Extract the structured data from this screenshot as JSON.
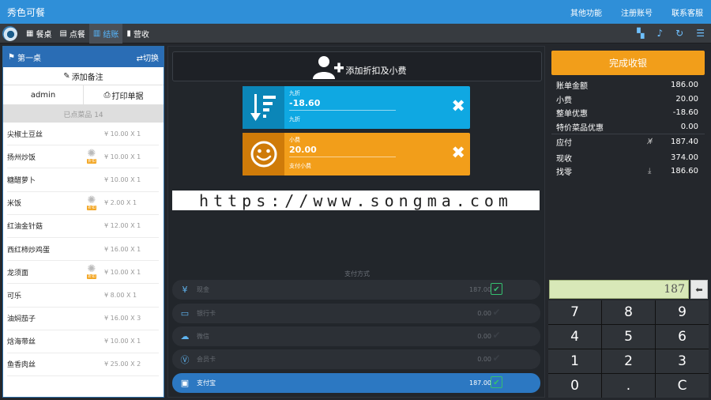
{
  "app": {
    "title": "秀色可餐"
  },
  "top_links": [
    "其他功能",
    "注册账号",
    "联系客服"
  ],
  "nav": {
    "tabs": [
      {
        "icon": "table-icon",
        "label": "餐桌"
      },
      {
        "icon": "book-icon",
        "label": "点餐"
      },
      {
        "icon": "checkout-icon",
        "label": "结账",
        "active": true
      },
      {
        "icon": "chart-icon",
        "label": "营收"
      }
    ],
    "right_icons": [
      "grid-icon",
      "bell-icon",
      "refresh-icon",
      "menu-icon"
    ]
  },
  "left": {
    "table_name": "第一桌",
    "switch_label": "⇄切换",
    "add_note_label": "添加备注",
    "user": "admin",
    "print_label": "打印单据",
    "ordered_header": "已点菜品 14",
    "dishes": [
      {
        "name": "尖椒土豆丝",
        "badge": false,
        "price": "¥ 10.00 X 1"
      },
      {
        "name": "扬州炒饭",
        "badge": true,
        "badge_text": "折扣",
        "price": "¥ 10.00 X 1"
      },
      {
        "name": "糖醋萝卜",
        "badge": false,
        "price": "¥ 10.00 X 1"
      },
      {
        "name": "米饭",
        "badge": true,
        "badge_text": "折扣",
        "price": "¥ 2.00 X 1"
      },
      {
        "name": "红油金针菇",
        "badge": false,
        "price": "¥ 12.00 X 1"
      },
      {
        "name": "西红柿炒鸡蛋",
        "badge": false,
        "price": "¥ 16.00 X 1"
      },
      {
        "name": "龙须面",
        "badge": true,
        "badge_text": "折扣",
        "price": "¥ 10.00 X 1"
      },
      {
        "name": "可乐",
        "badge": false,
        "price": "¥ 8.00 X 1"
      },
      {
        "name": "油焖茄子",
        "badge": false,
        "price": "¥ 16.00 X 3"
      },
      {
        "name": "焓海带丝",
        "badge": false,
        "price": "¥ 10.00 X 1"
      },
      {
        "name": "鱼香肉丝",
        "badge": false,
        "price": "¥ 25.00 X 2"
      }
    ]
  },
  "center": {
    "add_discount_label": "添加折扣及小费",
    "discount_card": {
      "label": "九折",
      "amount": "-18.60",
      "sub": "九折"
    },
    "tip_card": {
      "label": "小费",
      "amount": "20.00",
      "sub": "支付小费"
    },
    "payment_title": "支付方式",
    "payments": [
      {
        "icon": "yen-icon",
        "name": "现金",
        "amount": "187.00",
        "checked": true,
        "selected": false
      },
      {
        "icon": "bankcard-icon",
        "name": "银行卡",
        "amount": "0.00",
        "checked": false,
        "selected": false
      },
      {
        "icon": "wechat-icon",
        "name": "微信",
        "amount": "0.00",
        "checked": false,
        "selected": false
      },
      {
        "icon": "member-icon",
        "name": "会员卡",
        "amount": "0.00",
        "checked": false,
        "selected": false
      },
      {
        "icon": "alipay-icon",
        "name": "支付宝",
        "amount": "187.00",
        "checked": true,
        "selected": true
      }
    ]
  },
  "watermark": "https://www.songma.com",
  "right": {
    "complete_label": "完成收银",
    "summary": [
      {
        "label": "账单金额",
        "value": "186.00"
      },
      {
        "label": "小费",
        "value": "20.00"
      },
      {
        "label": "整单优惠",
        "value": "-18.60"
      },
      {
        "label": "特价菜品优惠",
        "value": "0.00"
      }
    ],
    "totals": [
      {
        "label": "应付",
        "value": "187.40",
        "icon": "yen-off-icon"
      },
      {
        "label": "现收",
        "value": "374.00"
      },
      {
        "label": "找零",
        "value": "186.60",
        "icon": "download-icon"
      }
    ],
    "display_value": "187",
    "keys": [
      "7",
      "8",
      "9",
      "4",
      "5",
      "6",
      "1",
      "2",
      "3",
      "0",
      ".",
      "C"
    ]
  },
  "colors": {
    "brand_blue": "#2f8fd8",
    "accent_orange": "#f29e1a",
    "discount_blue": "#0fa8e2",
    "check_green": "#35c070"
  }
}
